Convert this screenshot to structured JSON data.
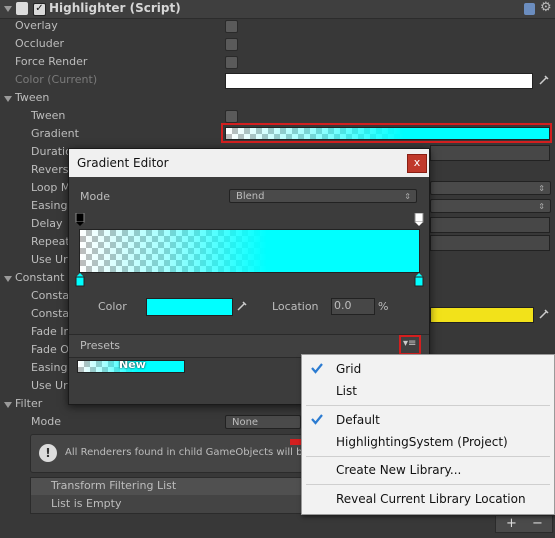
{
  "component": {
    "title": "Highlighter (Script)",
    "enabled": true
  },
  "properties": {
    "overlay": "Overlay",
    "occluder": "Occluder",
    "force_render": "Force Render",
    "color_current": "Color (Current)"
  },
  "tween": {
    "header": "Tween",
    "tween": "Tween",
    "gradient": "Gradient",
    "duration": "Duratio",
    "reverse": "Revers",
    "loop_mode": "Loop M",
    "easing": "Easing",
    "delay": "Delay",
    "repeat": "Repeat",
    "use_unscaled": "Use Ur"
  },
  "constant": {
    "header": "Constant",
    "row1": "Consta",
    "row2": "Consta",
    "fade_in": "Fade In",
    "fade_out": "Fade O",
    "easing": "Easing",
    "use_unscaled": "Use Ur",
    "color": "#f2e21a"
  },
  "filter": {
    "header": "Filter",
    "mode_label": "Mode",
    "mode_value": "None",
    "help_text": "All Renderers found in child GameObjects will b",
    "list_header": "Transform Filtering List",
    "list_empty": "List is Empty",
    "add": "+",
    "remove": "−"
  },
  "gradient_editor": {
    "title": "Gradient Editor",
    "close": "x",
    "mode_label": "Mode",
    "mode_value": "Blend",
    "color_label": "Color",
    "location_label": "Location",
    "location_value": "0.0",
    "location_unit": "%",
    "presets_label": "Presets",
    "preset_name": "New",
    "color": "#00ffff"
  },
  "context_menu": {
    "items": [
      {
        "label": "Grid",
        "checked": true
      },
      {
        "label": "List",
        "checked": false
      },
      {
        "label": "Default",
        "checked": true
      },
      {
        "label": "HighlightingSystem (Project)",
        "checked": false
      },
      {
        "label": "Create New Library...",
        "checked": false
      },
      {
        "label": "Reveal Current Library Location",
        "checked": false
      }
    ]
  },
  "colors": {
    "highlight_red": "#d31f1f",
    "check_blue": "#2b7bd1"
  }
}
